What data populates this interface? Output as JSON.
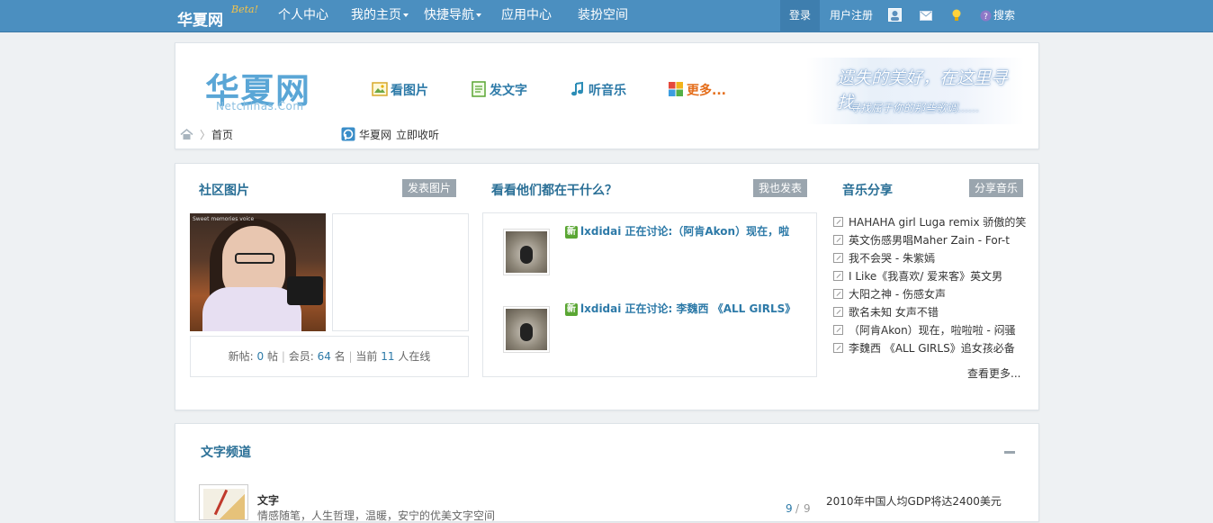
{
  "topbar": {
    "logo": "华夏网",
    "beta": "Beta!",
    "nav": [
      {
        "label": "个人中心"
      },
      {
        "label": "我的主页"
      },
      {
        "label": "快捷导航"
      },
      {
        "label": "应用中心"
      },
      {
        "label": "装扮空间"
      }
    ],
    "login": "登录",
    "register": "用户注册",
    "search": "搜索",
    "icons": [
      "user-icon",
      "mail-icon",
      "bulb-icon",
      "question-icon"
    ],
    "bg_color": "#4b8fc0"
  },
  "header": {
    "logo_text": "华夏网",
    "logo_sub": "Netchinas.Com",
    "quick_links": [
      {
        "label": "看图片",
        "icon": "picture-icon"
      },
      {
        "label": "发文字",
        "icon": "document-icon"
      },
      {
        "label": "听音乐",
        "icon": "music-icon"
      },
      {
        "label": "更多...",
        "icon": "apps-icon"
      }
    ],
    "banner_line1": "遗失的美好，在这里寻找",
    "banner_line2": "寻找属于你的那些歌调……",
    "breadcrumb_home": "首页",
    "radio_label": "华夏网",
    "radio_link": "立即收听"
  },
  "photos": {
    "title": "社区图片",
    "button": "发表图片",
    "image_caption": "Sweet memories voice",
    "stats_new_label": "新帖:",
    "stats_new": "0",
    "stats_new_unit": "帖",
    "stats_members_label": "会员:",
    "stats_members": "64",
    "stats_members_unit": "名",
    "stats_online_label": "当前",
    "stats_online": "11",
    "stats_online_unit": "人在线"
  },
  "feed": {
    "title": "看看他们都在干什么？",
    "button": "我也发表",
    "new_tag": "新",
    "items": [
      {
        "text": "lxdidai 正在讨论:（阿肯Akon）现在，啦"
      },
      {
        "text": "lxdidai 正在讨论: 李魏西 《ALL GIRLS》"
      }
    ]
  },
  "music": {
    "title": "音乐分享",
    "button": "分享音乐",
    "items": [
      {
        "label": "HAHAHA girl Luga remix 骄傲的笑"
      },
      {
        "label": "英文伤感男唱Maher Zain - For-t"
      },
      {
        "label": "我不会哭 - 朱紫嫣"
      },
      {
        "label": "I Like《我喜欢/ 爱来客》英文男"
      },
      {
        "label": "大阳之神 - 伤感女声"
      },
      {
        "label": "歌名未知 女声不错"
      },
      {
        "label": "（阿肯Akon）现在，啦啦啦 - 闷骚"
      },
      {
        "label": "李魏西 《ALL GIRLS》追女孩必备"
      }
    ],
    "more": "查看更多..."
  },
  "text_channel": {
    "title": "文字频道",
    "item_title": "文字",
    "item_desc": "情感随笔，人生哲理，温暖，安宁的优美文字空间",
    "page_current": "9",
    "page_sep": "/",
    "page_total": "9",
    "right_item": "2010年中国人均GDP将达2400美元"
  }
}
